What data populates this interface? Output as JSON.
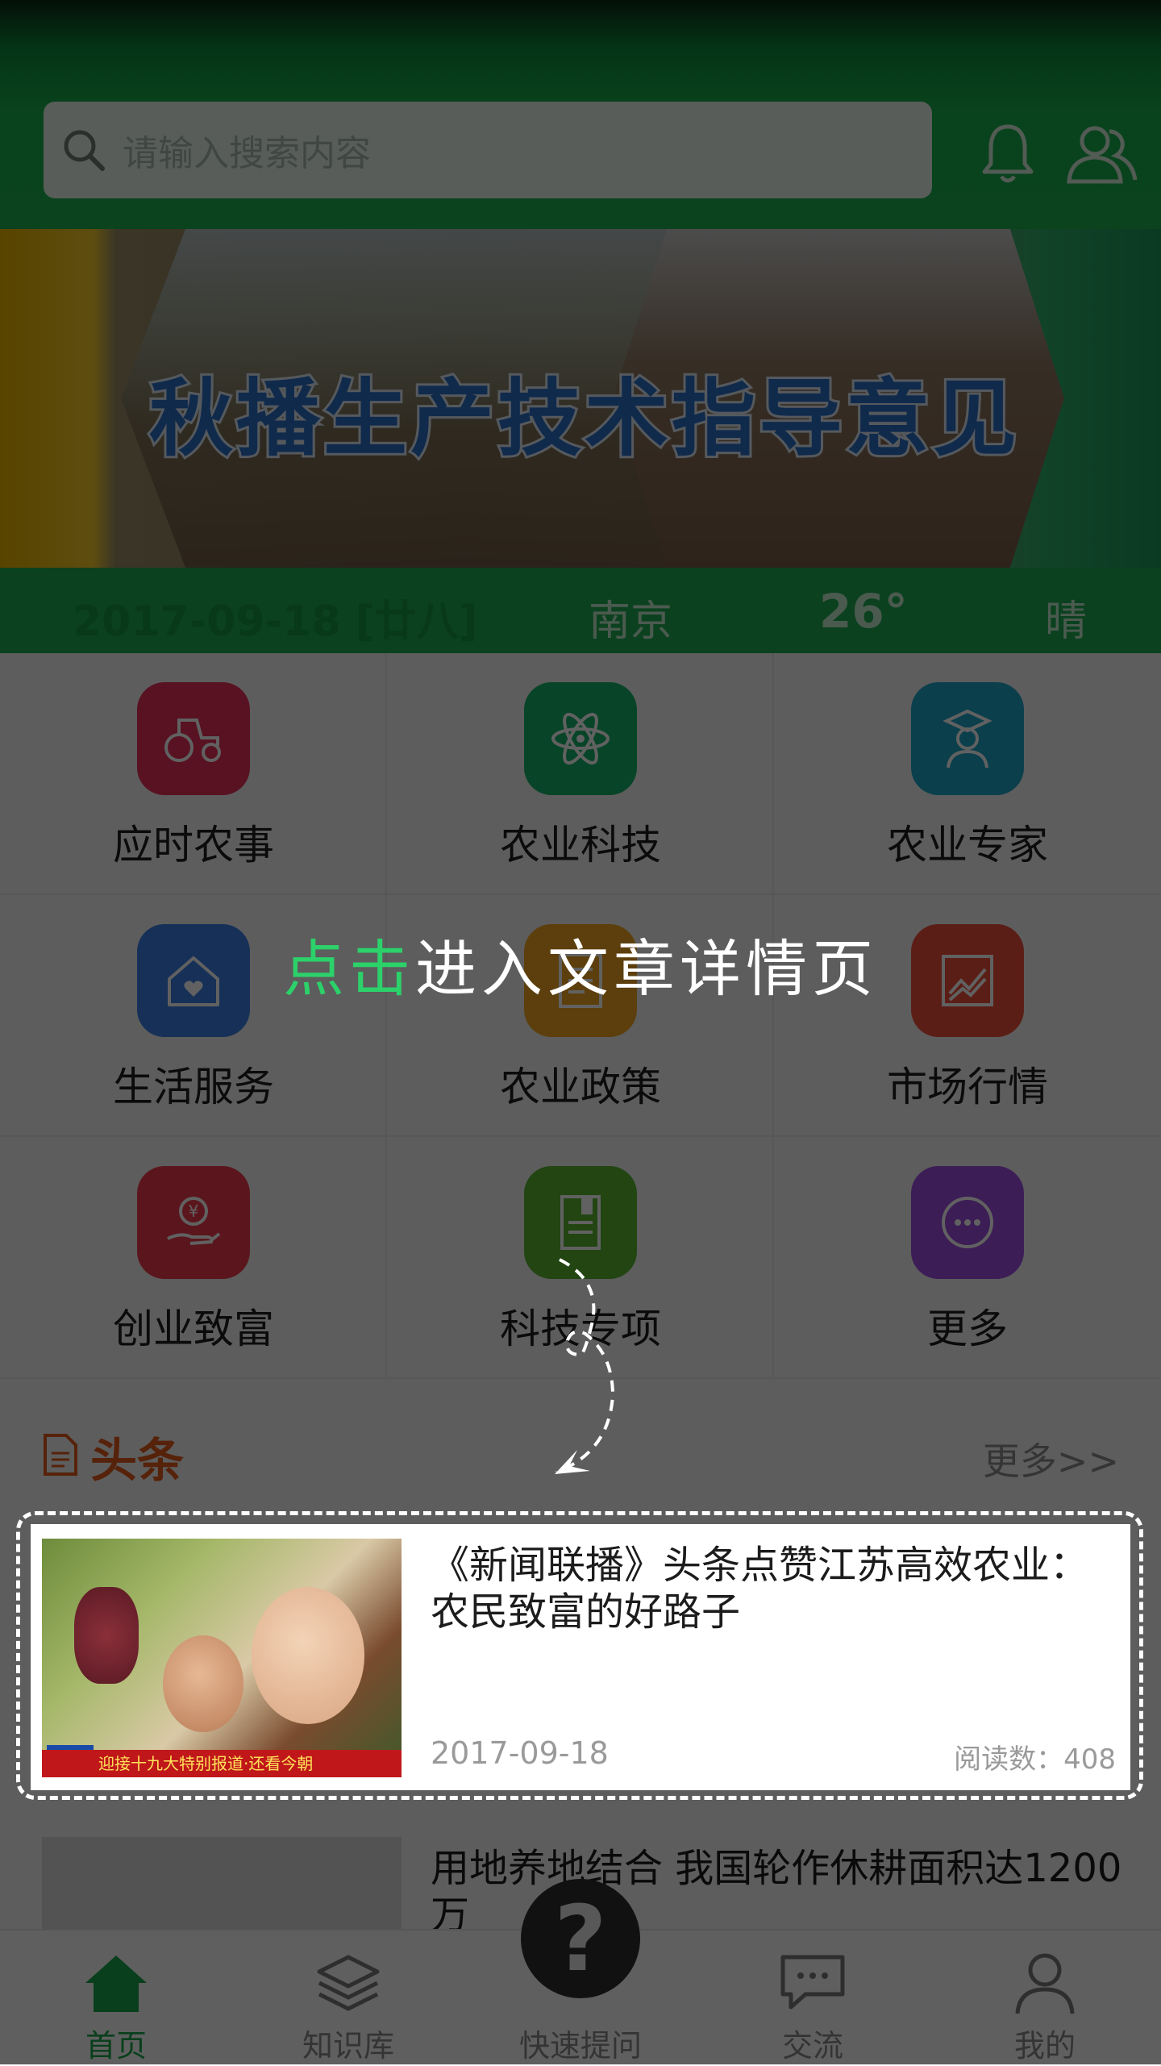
{
  "header": {
    "search_placeholder": "请输入搜索内容",
    "icons": [
      "search-icon",
      "bell-icon",
      "users-icon"
    ],
    "accent_color": "#1bb04d"
  },
  "banner": {
    "title": "秋播生产技术指导意见",
    "slide_count": 7,
    "active_slide": 1
  },
  "weather": {
    "date": "2017-09-18  [廿八]",
    "city": "南京",
    "temperature": "26°",
    "condition": "晴"
  },
  "grid": [
    {
      "label": "应时农事",
      "icon": "tractor-icon",
      "color": "#e8315a"
    },
    {
      "label": "农业科技",
      "icon": "atom-icon",
      "color": "#15b36b"
    },
    {
      "label": "农业专家",
      "icon": "expert-icon",
      "color": "#1fa5c9"
    },
    {
      "label": "生活服务",
      "icon": "home-heart-icon",
      "color": "#3c7ee8"
    },
    {
      "label": "农业政策",
      "icon": "policy-doc-icon",
      "color": "#f2a522"
    },
    {
      "label": "市场行情",
      "icon": "market-chart-icon",
      "color": "#ef4f3a"
    },
    {
      "label": "创业致富",
      "icon": "money-hand-icon",
      "color": "#ee3b4d"
    },
    {
      "label": "科技专项",
      "icon": "notebook-icon",
      "color": "#5bb631"
    },
    {
      "label": "更多",
      "icon": "more-dots-icon",
      "color": "#9d4de0"
    }
  ],
  "headlines": {
    "title": "头条",
    "more": "更多>>"
  },
  "featured": {
    "headline": "《新闻联播》头条点赞江苏高效农业：农民致富的好路子",
    "date": "2017-09-18",
    "reads": "阅读数：408",
    "thumb_caption": "迎接十九大特别报道·还看今朝"
  },
  "second_article": {
    "headline": "用地养地结合  我国轮作休耕面积达1200万"
  },
  "nav": [
    {
      "label": "首页",
      "icon": "home-icon",
      "active": true
    },
    {
      "label": "知识库",
      "icon": "layers-icon",
      "active": false
    },
    {
      "label": "快速提问",
      "icon": "question-icon",
      "active": false
    },
    {
      "label": "交流",
      "icon": "chat-icon",
      "active": false
    },
    {
      "label": "我的",
      "icon": "person-icon",
      "active": false
    }
  ],
  "guide": {
    "highlight": "点击",
    "rest": "进入文章详情页"
  }
}
